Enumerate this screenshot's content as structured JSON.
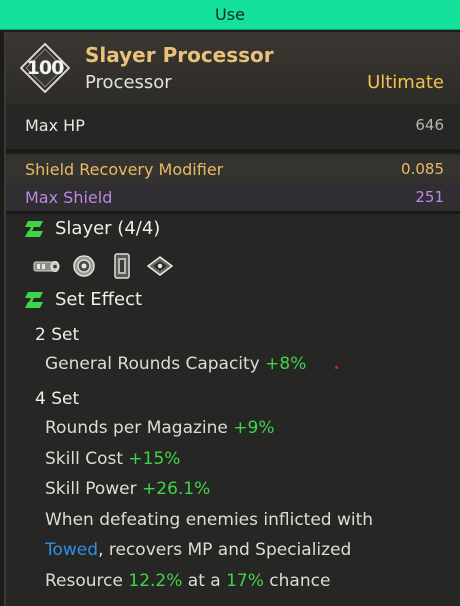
{
  "use_button": {
    "label": "Use"
  },
  "header": {
    "level": "100",
    "name": "Slayer Processor",
    "type": "Processor",
    "grade": "Ultimate"
  },
  "stats": {
    "max_hp": {
      "label": "Max HP",
      "value": "646"
    },
    "shield_recovery": {
      "label": "Shield Recovery Modifier",
      "value": "0.085"
    },
    "max_shield": {
      "label": "Max Shield",
      "value": "251"
    }
  },
  "set": {
    "title": "Slayer (4/4)",
    "piece_icons": [
      "cylinder-module-icon",
      "gear-disc-icon",
      "cartridge-icon",
      "eye-diamond-icon"
    ],
    "effect_title": "Set Effect",
    "tier2": {
      "label": "2 Set",
      "effects": [
        {
          "text": "General Rounds Capacity ",
          "bonus": "+8%"
        }
      ]
    },
    "tier4": {
      "label": "4 Set",
      "effects": [
        {
          "text": "Rounds per Magazine ",
          "bonus": "+9%"
        },
        {
          "text": "Skill Cost ",
          "bonus": "+15%"
        },
        {
          "text": "Skill Power ",
          "bonus": "+26.1%"
        }
      ],
      "special": {
        "line1": "When defeating enemies inflicted with",
        "keyword": "Towed",
        "line2_rest": ", recovers MP and Specialized",
        "line3_a": "Resource ",
        "line3_pct1": "12.2%",
        "line3_b": " at a ",
        "line3_pct2": "17%",
        "line3_c": " chance"
      }
    }
  },
  "colors": {
    "use_bar": "#14e29a",
    "name_gold": "#eac07a",
    "grade_gold": "#f0c24c",
    "bonus_green": "#3fd44a",
    "keyword_blue": "#2f8fe8",
    "shield_purple": "#b98ae2"
  }
}
